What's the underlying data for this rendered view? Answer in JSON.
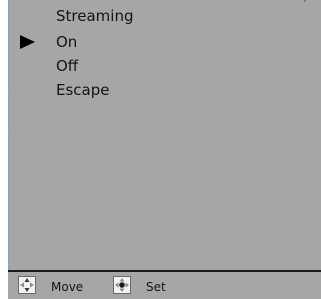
{
  "menu": {
    "title": "Streaming",
    "items": [
      "On",
      "Off",
      "Escape"
    ],
    "selected_label": "On"
  },
  "footer": {
    "move_label": "Move",
    "set_label": "Set",
    "move_icon": "dpad-move-icon",
    "set_icon": "dpad-set-icon"
  },
  "colors": {
    "panel": "#a6a6a6",
    "text": "#141414",
    "selector": "#000000"
  }
}
